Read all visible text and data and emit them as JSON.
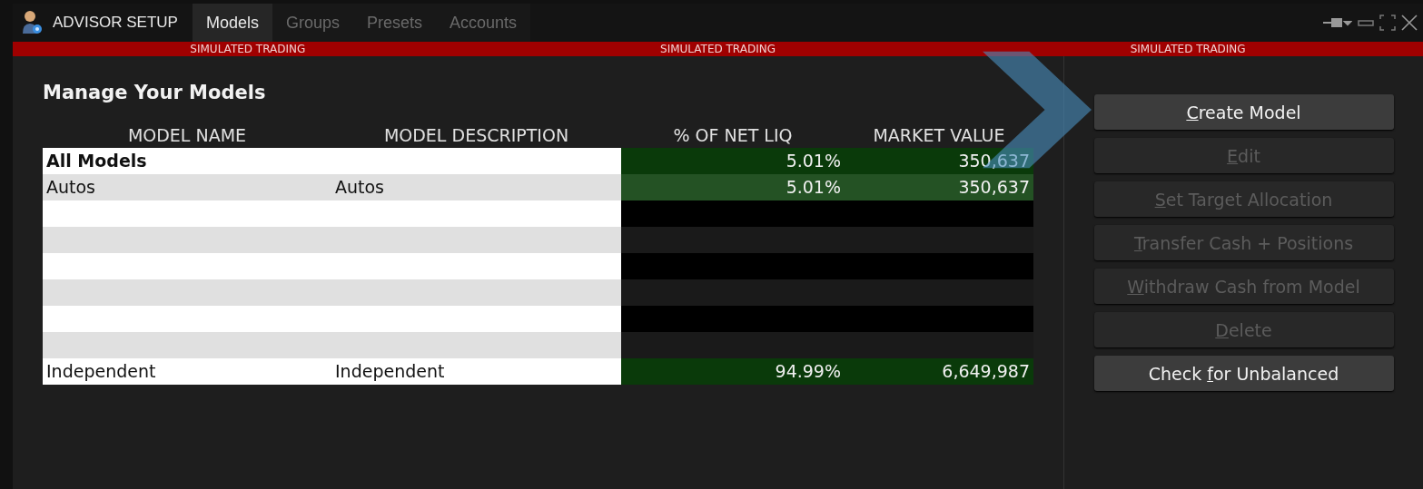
{
  "window": {
    "title": "ADVISOR SETUP"
  },
  "tabs": [
    {
      "label": "Models",
      "selected": true
    },
    {
      "label": "Groups",
      "selected": false
    },
    {
      "label": "Presets",
      "selected": false
    },
    {
      "label": "Accounts",
      "selected": false
    }
  ],
  "banner": [
    "SIMULATED TRADING",
    "SIMULATED TRADING",
    "SIMULATED TRADING"
  ],
  "heading": "Manage Your Models",
  "table": {
    "columns": [
      "MODEL NAME",
      "MODEL DESCRIPTION",
      "% OF NET LIQ",
      "MARKET VALUE"
    ],
    "rows": [
      {
        "kind": "total",
        "cells": [
          "All Models",
          "",
          "5.01%",
          "350,637"
        ]
      },
      {
        "kind": "model",
        "cells": [
          "Autos",
          "Autos",
          "5.01%",
          "350,637"
        ]
      },
      {
        "kind": "empty",
        "cells": []
      },
      {
        "kind": "empty",
        "cells": []
      },
      {
        "kind": "empty",
        "cells": []
      },
      {
        "kind": "empty",
        "cells": []
      },
      {
        "kind": "empty",
        "cells": []
      },
      {
        "kind": "empty",
        "cells": []
      },
      {
        "kind": "model",
        "cells": [
          "Independent",
          "Independent",
          "94.99%",
          "6,649,987"
        ]
      }
    ]
  },
  "buttons": [
    {
      "key": "C",
      "rest": "reate Model",
      "disabled": false
    },
    {
      "key": "E",
      "rest": "dit",
      "disabled": true
    },
    {
      "key": "S",
      "rest": "et Target Allocation",
      "disabled": true
    },
    {
      "key": "T",
      "rest": "ransfer Cash + Positions",
      "disabled": true
    },
    {
      "key": "W",
      "rest": "ithdraw Cash from Model",
      "disabled": true
    },
    {
      "key": "D",
      "rest": "elete",
      "disabled": true
    },
    {
      "lead": "Check ",
      "key": "f",
      "rest": "or Unbalanced",
      "disabled": false
    }
  ]
}
